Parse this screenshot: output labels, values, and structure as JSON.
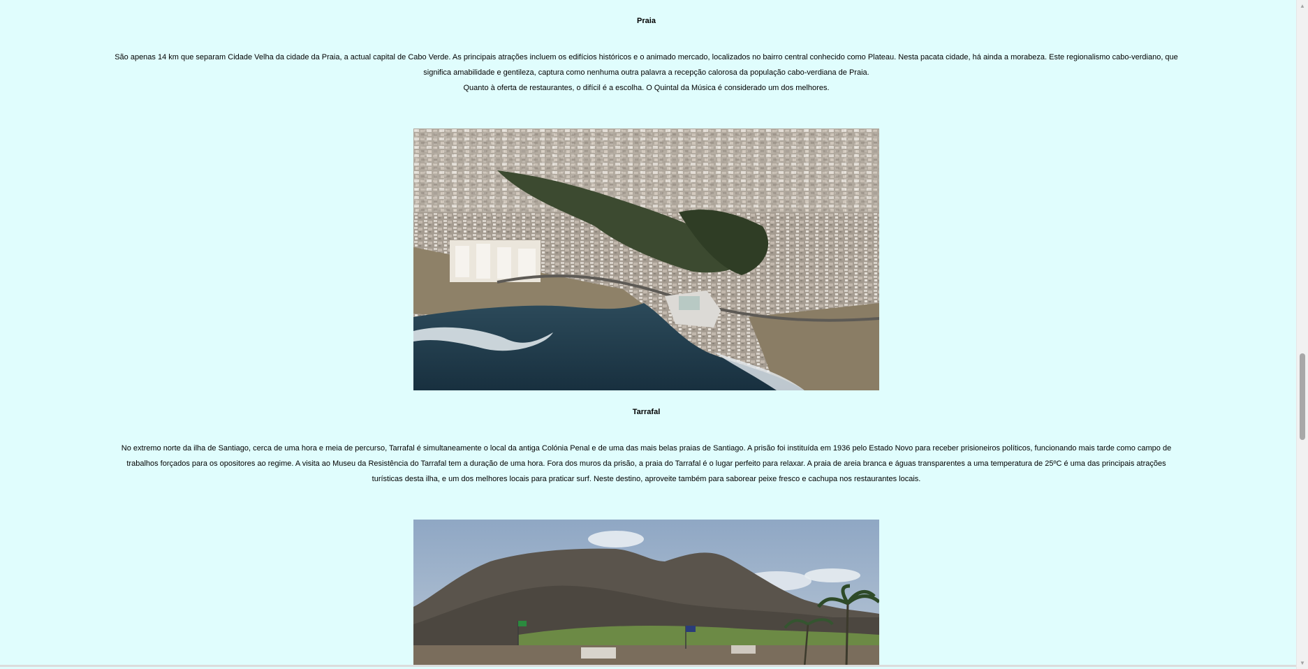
{
  "sections": [
    {
      "title": "Praia",
      "paragraph_lines": [
        "São apenas 14 km que separam Cidade Velha da cidade da Praia, a actual capital de Cabo Verde. As principais atrações incluem os edifícios históricos e o animado mercado, localizados no bairro central conhecido como Plateau. Nesta pacata cidade, há ainda a morabeza. Este regionalismo cabo-verdiano, que",
        "significa amabilidade e gentileza, captura como nenhuma outra palavra a recepção calorosa da população cabo-verdiana de Praia.",
        "Quanto à oferta de restaurantes, o difícil é a escolha. O Quintal da Música é considerado um dos melhores."
      ]
    },
    {
      "title": "Tarrafal",
      "paragraph_lines": [
        "No extremo norte da ilha de Santiago, cerca de uma hora e meia de percurso, Tarrafal é simultaneamente o local da antiga Colónia Penal e de uma das mais belas praias de Santiago. A prisão foi instituída em 1936 pelo Estado Novo para receber prisioneiros políticos, funcionando mais tarde como campo de",
        "trabalhos forçados para os opositores ao regime. A visita ao Museu da Resistência do Tarrafal tem a duração de uma hora. Fora dos muros da prisão, a praia do Tarrafal é o lugar perfeito para relaxar. A praia de areia branca e águas transparentes a uma temperatura de 25ºC é uma das principais atrações",
        "turísticas desta ilha, e um dos melhores locais para praticar surf. Neste destino, aproveite também para saborear peixe fresco e cachupa nos restaurantes locais."
      ]
    }
  ],
  "icons": {
    "scroll_up": "chevron-up-icon",
    "scroll_down": "chevron-down-icon"
  },
  "colors": {
    "page_background": "#e0fdfd"
  }
}
